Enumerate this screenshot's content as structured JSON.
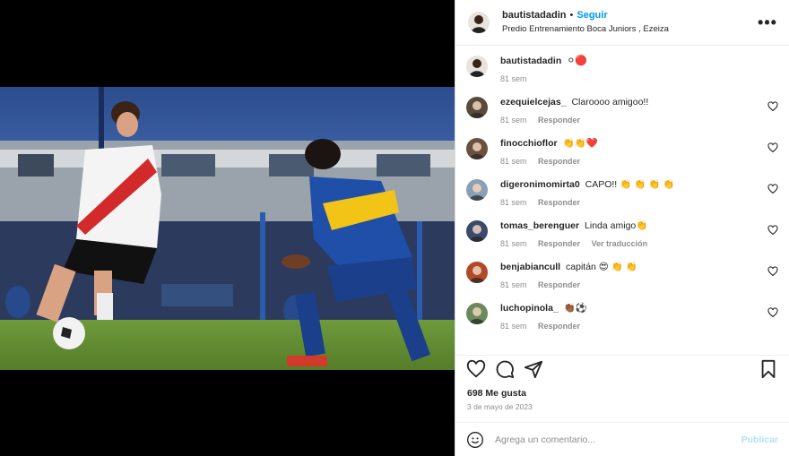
{
  "post": {
    "username": "bautistadadin",
    "separator": "•",
    "follow_label": "Seguir",
    "location": "Predio Entrenamiento Boca Juniors , Ezeiza",
    "more_label": "•••"
  },
  "caption": {
    "username": "bautistadadin",
    "emojis": "⚪🔴",
    "time": "81 sem"
  },
  "comments": [
    {
      "username": "ezequielcejas_",
      "text": "Claroooo amigoo!!",
      "time": "81 sem",
      "reply": "Responder",
      "translate": "",
      "avatar_color": "#5a4a3c"
    },
    {
      "username": "finocchioflor",
      "text": "👏👏❤️",
      "time": "81 sem",
      "reply": "Responder",
      "translate": "",
      "avatar_color": "#6b5040"
    },
    {
      "username": "digeronimomirta0",
      "text": "CAPO!! 👏 👏 👏 👏",
      "time": "81 sem",
      "reply": "Responder",
      "translate": "",
      "avatar_color": "#8aa0b4"
    },
    {
      "username": "tomas_berenguer",
      "text": "Linda amigo👏",
      "time": "81 sem",
      "reply": "Responder",
      "translate": "Ver traducción",
      "avatar_color": "#3b4a6a"
    },
    {
      "username": "benjabiancull",
      "text": "capitán 😍 👏 👏",
      "time": "81 sem",
      "reply": "Responder",
      "translate": "",
      "avatar_color": "#b04a2a"
    },
    {
      "username": "luchopinola_",
      "text": "👏🏾⚽",
      "time": "81 sem",
      "reply": "Responder",
      "translate": "",
      "avatar_color": "#6a8a5a"
    }
  ],
  "likes": "698 Me gusta",
  "date": "3 de mayo de 2023",
  "add_comment": {
    "placeholder": "Agrega un comentario...",
    "publish_label": "Publicar"
  },
  "icons": [
    "heart-icon",
    "comment-icon",
    "share-icon",
    "bookmark-icon",
    "emoji-icon",
    "more-icon"
  ],
  "colors": {
    "follow": "#0095f6",
    "publish": "#b2dffc",
    "muted": "#8e8e8e"
  }
}
